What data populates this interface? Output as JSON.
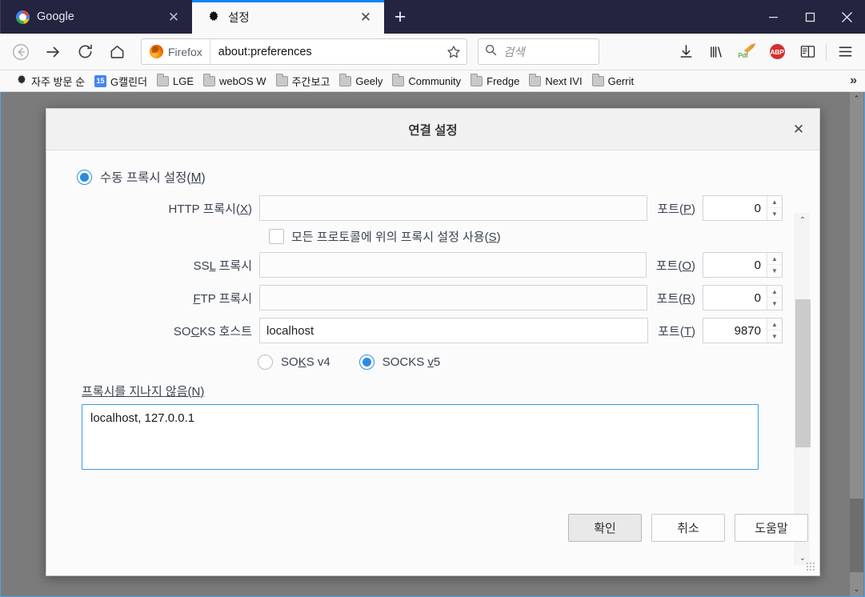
{
  "window": {
    "minimize_label": "−",
    "maximize_label": "□",
    "close_label": "✕"
  },
  "tabs": [
    {
      "title": "Google",
      "favicon": "google-icon",
      "close_label": "✕",
      "active": false
    },
    {
      "title": "설정",
      "favicon": "gear-icon",
      "close_label": "✕",
      "active": true
    }
  ],
  "newtab_label": "+",
  "toolbar": {
    "back_label": "←",
    "forward_label": "→",
    "reload_label": "↻",
    "home_label": "⌂",
    "identity_label": "Firefox",
    "url": "about:preferences",
    "bookmark_star": "☆",
    "search_placeholder": "검색",
    "search_icon": "search-icon",
    "downloads_label": "↓",
    "library_label": "library-icon",
    "pdf_label": "Pdf",
    "abp_label": "ABP",
    "sidebar_label": "sidebar-icon",
    "menu_label": "☰"
  },
  "bookmarks": {
    "items": [
      {
        "label": "자주 방문 순",
        "icon": "star-gear-icon"
      },
      {
        "label": "G캘린더",
        "icon": "gcal-icon",
        "icon_text": "15"
      },
      {
        "label": "LGE",
        "icon": "folder-icon"
      },
      {
        "label": "webOS W",
        "icon": "folder-icon"
      },
      {
        "label": "주간보고",
        "icon": "folder-icon"
      },
      {
        "label": "Geely",
        "icon": "folder-icon"
      },
      {
        "label": "Community",
        "icon": "folder-icon"
      },
      {
        "label": "Fredge",
        "icon": "folder-icon"
      },
      {
        "label": "Next IVI",
        "icon": "folder-icon"
      },
      {
        "label": "Gerrit",
        "icon": "folder-icon"
      }
    ],
    "overflow_label": "»"
  },
  "dialog": {
    "title": "연결 설정",
    "close_label": "✕",
    "manual_proxy": {
      "label_prefix": "수동 프록시 설정(",
      "accesskey": "M",
      "label_suffix": ")",
      "selected": true
    },
    "fields": [
      {
        "label_prefix": "HTTP 프록시(",
        "accesskey": "X",
        "label_suffix": ")",
        "value": "",
        "port_label_prefix": "포트(",
        "port_accesskey": "P",
        "port_label_suffix": ")",
        "port_value": "0"
      },
      {
        "label_prefix": "SS",
        "accesskey": "L",
        "label_suffix": " 프록시",
        "value": "",
        "port_label_prefix": "포트(",
        "port_accesskey": "O",
        "port_label_suffix": ")",
        "port_value": "0"
      },
      {
        "label_prefix": "",
        "accesskey": "F",
        "label_suffix": "TP 프록시",
        "value": "",
        "port_label_prefix": "포트(",
        "port_accesskey": "R",
        "port_label_suffix": ")",
        "port_value": "0"
      },
      {
        "label_prefix": "SO",
        "accesskey": "C",
        "label_suffix": "KS 호스트",
        "value": "localhost",
        "port_label_prefix": "포트(",
        "port_accesskey": "T",
        "port_label_suffix": ")",
        "port_value": "9870"
      }
    ],
    "use_for_all": {
      "label_prefix": "모든 프로토콜에 위의 프록시 설정 사용(",
      "accesskey": "S",
      "label_suffix": ")",
      "checked": false
    },
    "socks_v4": {
      "label_prefix": "SO",
      "accesskey": "K",
      "label_suffix": "S v4",
      "selected": false
    },
    "socks_v5": {
      "label_prefix": "SOCKS ",
      "accesskey": "v",
      "label_suffix": "5",
      "selected": true
    },
    "no_proxy": {
      "label_prefix": "프록시를 지나지 않음(",
      "accesskey": "N",
      "label_suffix": ")",
      "value": "localhost, 127.0.0.1"
    },
    "buttons": {
      "ok": "확인",
      "cancel": "취소",
      "help": "도움말"
    },
    "scroll_up_label": "⌃",
    "scroll_down_label": "⌄"
  },
  "page_scroll": {
    "up_label": "⌃",
    "down_label": "⌄"
  },
  "colors": {
    "accent": "#0a84ff",
    "titlebar": "#23243f",
    "overlay": "#7b7b7b",
    "radio_on": "#2b8ae0",
    "focus_border": "#3b9bea"
  }
}
